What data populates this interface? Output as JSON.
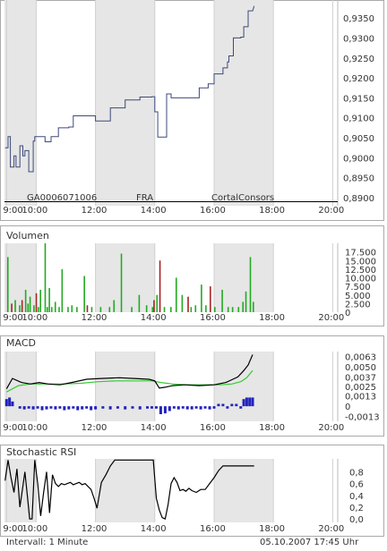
{
  "footer": {
    "interval": "Intervall: 1 Minute",
    "datetime": "05.10.2007   17:45 Uhr"
  },
  "watermark": {
    "isin": "GA0006071006",
    "exchange": "FRA",
    "brand": "CortalConsors"
  },
  "colors": {
    "price_line": "#3d4a7a",
    "volume_up": "#22aa22",
    "volume_down": "#aa2222",
    "macd_line": "#000000",
    "signal_line": "#33cc33",
    "histogram": "#2222bb",
    "stoch_line": "#000000",
    "shade": "#e6e6e6",
    "grid": "#d0d0d0",
    "frame": "#aaaaaa",
    "baseline": "#000000"
  },
  "chart_data": [
    {
      "id": "price",
      "type": "line",
      "title": "",
      "x_ticks": [
        "9:00",
        "10:00",
        "12:00",
        "14:00",
        "16:00",
        "18:00",
        "20:00"
      ],
      "y_ticks": [
        "0,9350",
        "0,9300",
        "0,9250",
        "0,9200",
        "0,9150",
        "0,9100",
        "0,9050",
        "0,9000",
        "0,8950",
        "0,8900"
      ],
      "ylim": [
        0.888,
        0.9395
      ],
      "xlim": [
        8.93,
        20.17
      ],
      "baseline": 0.889,
      "series": [
        {
          "x": [
            8.95,
            9.05,
            9.05,
            9.13,
            9.13,
            9.25,
            9.25,
            9.32,
            9.32,
            9.45,
            9.45,
            9.55,
            9.55,
            9.62,
            9.62,
            9.75,
            9.75,
            9.9,
            9.9,
            9.95,
            9.95,
            10.3,
            10.3,
            10.5,
            10.5,
            10.75,
            10.75,
            11.1,
            11.1,
            11.25,
            11.25,
            12.0,
            12.0,
            12.5,
            12.5,
            13.0,
            13.0,
            13.5,
            13.5,
            13.9,
            13.9,
            14.0,
            14.0,
            14.1,
            14.1,
            14.4,
            14.4,
            14.55,
            14.55,
            15.5,
            15.5,
            15.8,
            15.8,
            16.0,
            16.0,
            16.3,
            16.3,
            16.45,
            16.45,
            16.5,
            16.5,
            16.65,
            16.65,
            16.9,
            16.9,
            17.0,
            17.0,
            17.15,
            17.15,
            17.3,
            17.35
          ],
          "values": [
            0.9025,
            0.9025,
            0.9053,
            0.9053,
            0.8977,
            0.8977,
            0.9005,
            0.9005,
            0.8977,
            0.8977,
            0.903,
            0.903,
            0.9005,
            0.9005,
            0.9018,
            0.9018,
            0.8965,
            0.8965,
            0.9042,
            0.9042,
            0.9053,
            0.9053,
            0.904,
            0.904,
            0.9053,
            0.9053,
            0.9075,
            0.9075,
            0.9077,
            0.9077,
            0.9105,
            0.9105,
            0.9092,
            0.9092,
            0.9125,
            0.9125,
            0.9145,
            0.9145,
            0.9152,
            0.9152,
            0.9153,
            0.9153,
            0.9115,
            0.9115,
            0.9052,
            0.9052,
            0.916,
            0.916,
            0.915,
            0.915,
            0.9175,
            0.9175,
            0.9185,
            0.9185,
            0.921,
            0.921,
            0.9225,
            0.9225,
            0.924,
            0.924,
            0.9255,
            0.9255,
            0.93,
            0.93,
            0.9302,
            0.9302,
            0.9328,
            0.9328,
            0.9368,
            0.9368,
            0.938
          ]
        }
      ]
    },
    {
      "id": "volume",
      "type": "bar",
      "title": "Volumen",
      "x_ticks": [
        "9:00",
        "10:00",
        "12:00",
        "14:00",
        "16:00",
        "18:00",
        "20:00"
      ],
      "y_ticks": [
        "17.500",
        "15.000",
        "12.500",
        "10.000",
        "7.500",
        "5.000",
        "2.500",
        "0"
      ],
      "ylim": [
        0,
        20000
      ],
      "xlim": [
        8.93,
        20.17
      ],
      "series": [
        {
          "name": "up",
          "x": [
            9.02,
            9.27,
            9.42,
            9.62,
            9.7,
            9.77,
            9.9,
            10.05,
            10.12,
            10.28,
            10.35,
            10.42,
            10.5,
            10.62,
            10.75,
            10.85,
            11.05,
            11.18,
            11.35,
            11.6,
            11.85,
            12.15,
            12.45,
            12.6,
            12.85,
            13.2,
            13.45,
            13.7,
            13.9,
            14.05,
            14.3,
            14.52,
            14.7,
            14.9,
            15.2,
            15.35,
            15.55,
            15.7,
            16.0,
            16.25,
            16.45,
            16.6,
            16.8,
            16.95,
            17.05,
            17.2,
            17.3
          ],
          "values": [
            16000,
            3500,
            2000,
            6500,
            2500,
            4500,
            2000,
            1500,
            6500,
            20000,
            1500,
            7000,
            1500,
            3000,
            1500,
            12500,
            1500,
            2000,
            1500,
            10500,
            1500,
            1500,
            1500,
            3500,
            17000,
            1500,
            5000,
            2000,
            1500,
            5000,
            1500,
            1500,
            10000,
            5000,
            1500,
            2000,
            8000,
            2000,
            1500,
            6500,
            1500,
            1500,
            1500,
            3000,
            6000,
            16000,
            3000
          ]
        },
        {
          "name": "down",
          "x": [
            9.15,
            9.5,
            9.98,
            11.7,
            13.95,
            14.15,
            15.1,
            15.85
          ],
          "values": [
            2500,
            3500,
            5500,
            2000,
            3500,
            15000,
            4500,
            7500
          ]
        }
      ]
    },
    {
      "id": "macd",
      "type": "line",
      "title": "MACD",
      "x_ticks": [
        "9:00",
        "10:00",
        "12:00",
        "14:00",
        "16:00",
        "18:00",
        "20:00"
      ],
      "y_ticks": [
        "0,0063",
        "0,0050",
        "0,0037",
        "0,0025",
        "0,0013",
        "0",
        "-0,0013"
      ],
      "ylim": [
        -0.0019,
        0.0069
      ],
      "xlim": [
        8.93,
        20.17
      ],
      "series": [
        {
          "name": "MACD",
          "x": [
            9.0,
            9.2,
            9.5,
            9.8,
            10.1,
            10.4,
            10.8,
            11.2,
            11.7,
            12.2,
            12.8,
            13.3,
            13.8,
            14.0,
            14.15,
            14.35,
            14.6,
            15.0,
            15.5,
            16.0,
            16.4,
            16.8,
            17.0,
            17.15,
            17.3
          ],
          "values": [
            0.0022,
            0.0035,
            0.003,
            0.0028,
            0.003,
            0.0028,
            0.0027,
            0.003,
            0.0034,
            0.0035,
            0.0036,
            0.0035,
            0.0034,
            0.0032,
            0.0023,
            0.0024,
            0.0026,
            0.0027,
            0.0026,
            0.0027,
            0.003,
            0.0037,
            0.0045,
            0.0052,
            0.0065
          ]
        },
        {
          "name": "Signal",
          "x": [
            9.0,
            9.4,
            9.8,
            10.3,
            10.9,
            11.5,
            12.1,
            12.7,
            13.3,
            13.9,
            14.2,
            14.6,
            15.1,
            15.7,
            16.2,
            16.6,
            16.9,
            17.1,
            17.3
          ],
          "values": [
            0.0018,
            0.0026,
            0.0028,
            0.0028,
            0.0028,
            0.0029,
            0.0031,
            0.0032,
            0.0032,
            0.0032,
            0.003,
            0.0028,
            0.0027,
            0.0027,
            0.0027,
            0.0028,
            0.0031,
            0.0036,
            0.0045
          ]
        },
        {
          "name": "Histogram",
          "x": [
            9.0,
            9.1,
            9.2,
            9.45,
            9.6,
            9.75,
            9.9,
            10.05,
            10.2,
            10.35,
            10.5,
            10.65,
            10.8,
            10.95,
            11.1,
            11.25,
            11.4,
            11.55,
            11.7,
            11.85,
            12.0,
            12.25,
            12.5,
            12.75,
            13.0,
            13.25,
            13.5,
            13.75,
            13.9,
            14.05,
            14.2,
            14.35,
            14.5,
            14.65,
            14.8,
            14.95,
            15.1,
            15.25,
            15.4,
            15.55,
            15.7,
            15.85,
            16.0,
            16.15,
            16.3,
            16.45,
            16.6,
            16.75,
            16.9,
            17.0,
            17.1,
            17.2,
            17.3
          ],
          "values": [
            0.0009,
            0.0011,
            0.0006,
            -0.0003,
            -0.0004,
            -0.0003,
            -0.0004,
            -0.0003,
            -0.0005,
            -0.0004,
            -0.0003,
            -0.0004,
            -0.0003,
            -0.0005,
            -0.0004,
            -0.0003,
            -0.0005,
            -0.0004,
            -0.0003,
            -0.0005,
            -0.0004,
            -0.0003,
            -0.0004,
            -0.0003,
            -0.0004,
            -0.0003,
            -0.0004,
            -0.0003,
            -0.0003,
            -0.0003,
            -0.001,
            -0.0009,
            -0.0006,
            -0.0003,
            -0.0004,
            -0.0003,
            -0.0004,
            -0.0004,
            -0.0003,
            -0.0004,
            -0.0003,
            -0.0004,
            -0.0003,
            0.0003,
            0.0003,
            -0.0003,
            0.0003,
            0.0003,
            -0.0003,
            0.0009,
            0.0011,
            0.0011,
            0.0011
          ]
        }
      ]
    },
    {
      "id": "stochrsi",
      "type": "line",
      "title": "Stochastic RSI",
      "x_ticks": [
        "9:00",
        "10:00",
        "12:00",
        "14:00",
        "16:00",
        "18:00",
        "20:00"
      ],
      "y_ticks": [
        "0,8",
        "0,6",
        "0,4",
        "0,2",
        "0,0"
      ],
      "ylim": [
        -0.06,
        1.02
      ],
      "xlim": [
        8.93,
        20.17
      ],
      "series": [
        {
          "name": "StochRSI",
          "x": [
            8.95,
            9.05,
            9.15,
            9.25,
            9.35,
            9.45,
            9.55,
            9.62,
            9.7,
            9.78,
            9.86,
            9.95,
            10.05,
            10.15,
            10.25,
            10.35,
            10.45,
            10.55,
            10.65,
            10.75,
            10.85,
            10.95,
            11.05,
            11.15,
            11.25,
            11.35,
            11.45,
            11.55,
            11.65,
            11.75,
            11.85,
            11.95,
            12.05,
            12.2,
            12.35,
            12.5,
            12.65,
            12.8,
            12.9,
            13.0,
            13.1,
            13.2,
            13.35,
            13.5,
            13.65,
            13.8,
            13.95,
            14.05,
            14.15,
            14.25,
            14.35,
            14.45,
            14.55,
            14.65,
            14.75,
            14.85,
            14.95,
            15.05,
            15.15,
            15.25,
            15.4,
            15.55,
            15.7,
            15.85,
            16.0,
            16.15,
            16.3,
            16.45,
            16.6,
            16.75,
            16.9,
            17.05,
            17.2,
            17.35
          ],
          "values": [
            0.65,
            1.0,
            0.7,
            0.45,
            0.85,
            0.2,
            0.55,
            0.8,
            0.4,
            0.0,
            0.0,
            1.0,
            0.6,
            0.05,
            0.45,
            0.8,
            0.1,
            0.75,
            0.6,
            0.55,
            0.6,
            0.58,
            0.6,
            0.62,
            0.58,
            0.6,
            0.62,
            0.58,
            0.6,
            0.55,
            0.5,
            0.35,
            0.18,
            0.62,
            0.75,
            0.9,
            1.0,
            1.0,
            1.0,
            1.0,
            1.0,
            1.0,
            1.0,
            1.0,
            1.0,
            1.0,
            1.0,
            0.35,
            0.15,
            0.02,
            0.0,
            0.25,
            0.6,
            0.7,
            0.62,
            0.48,
            0.5,
            0.47,
            0.52,
            0.48,
            0.45,
            0.5,
            0.5,
            0.6,
            0.7,
            0.82,
            0.9,
            0.9,
            0.9,
            0.9,
            0.9,
            0.9,
            0.9,
            0.9
          ]
        }
      ]
    }
  ]
}
